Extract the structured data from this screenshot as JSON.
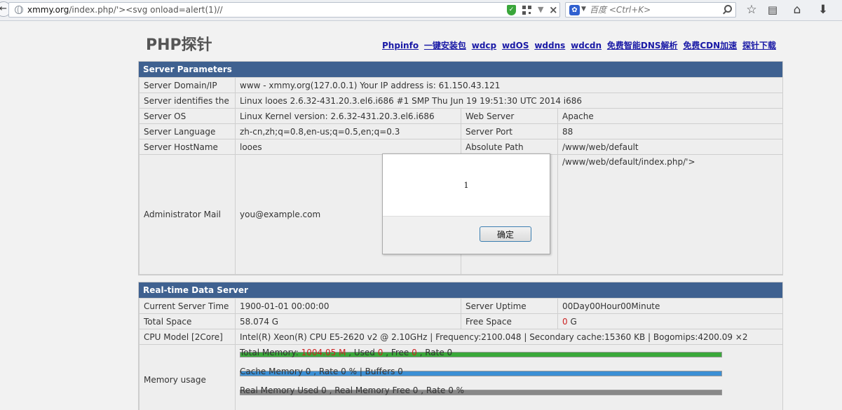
{
  "browser": {
    "url_host": "xmmy.org",
    "url_rest": "/index.php/'><svg onload=alert(1)//",
    "search_placeholder": "百度 <Ctrl+K>",
    "back_icon": "back-arrow-icon",
    "shield_icon": "shield-icon",
    "qr_icon": "qr-code-icon",
    "icons": [
      "star-icon",
      "reading-list-icon",
      "home-icon",
      "download-icon"
    ]
  },
  "page": {
    "title": "PHP探针",
    "nav_links": [
      "Phpinfo",
      "一键安装包",
      "wdcp",
      "wdOS",
      "wddns",
      "wdcdn",
      "免费智能DNS解析",
      "免费CDN加速",
      "探针下载"
    ]
  },
  "server_params": {
    "heading": "Server Parameters",
    "domain_label": "Server Domain/IP",
    "domain_value": "www - xmmy.org(127.0.0.1)  Your IP address is: 61.150.43.121",
    "identifies_label": "Server identifies the",
    "identifies_value": "Linux looes 2.6.32-431.20.3.el6.i686 #1 SMP Thu Jun 19 19:51:30 UTC 2014 i686",
    "os_label": "Server OS",
    "os_value": "Linux  Kernel version: 2.6.32-431.20.3.el6.i686",
    "webserver_label": "Web Server",
    "webserver_value": "Apache",
    "lang_label": "Server Language",
    "lang_value": "zh-cn,zh;q=0.8,en-us;q=0.5,en;q=0.3",
    "port_label": "Server Port",
    "port_value": "88",
    "hostname_label": "Server HostName",
    "hostname_value": "looes",
    "abspath_label": "Absolute Path",
    "abspath_value": "/www/web/default",
    "mail_label": "Administrator Mail",
    "mail_value": "you@example.com",
    "probe_path_value": "/www/web/default/index.php/'>"
  },
  "realtime": {
    "heading": "Real-time Data Server",
    "time_label": "Current Server Time",
    "time_value": "1900-01-01 00:00:00",
    "uptime_label": "Server Uptime",
    "uptime_value": "00Day00Hour00Minute",
    "space_label": "Total Space",
    "space_value": "58.074 G",
    "free_label": "Free Space",
    "free_value": "0",
    "free_unit": " G",
    "cpu_label": "CPU Model [2Core]",
    "cpu_value": "Intel(R) Xeon(R) CPU E5-2620 v2 @ 2.10GHz | Frequency:2100.048 | Secondary cache:15360 KB | Bogomips:4200.09 ×2",
    "mem_label": "Memory usage",
    "total_mem_prefix": "Total Memory: ",
    "total_mem_value": "1004.05 M",
    "used_prefix": " , Used ",
    "used_value": "0",
    "free_prefix": " , Free ",
    "free_mem_value": "0",
    "rate_suffix": " , Rate 0",
    "cache_line": "Cache Memory 0 , Rate 0 % | Buffers 0",
    "real_line": "Real Memory Used 0 , Real Memory Free 0 , Rate 0 %",
    "bar_colors": [
      "#3aa83a",
      "#3b8fd4",
      "#888888"
    ],
    "bar_levels": [
      1.0,
      1.0,
      1.0
    ]
  },
  "dialog": {
    "message": "1",
    "ok_label": "确定"
  }
}
